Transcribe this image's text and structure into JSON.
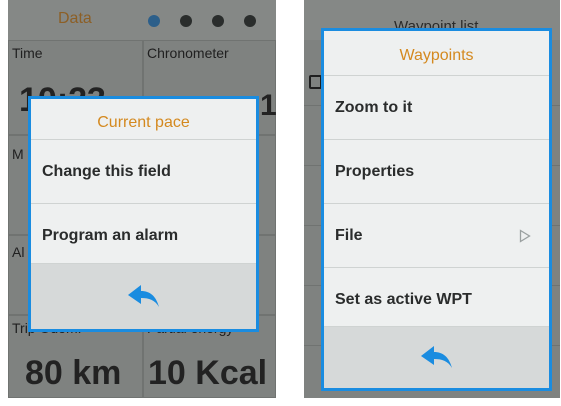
{
  "left": {
    "background": {
      "tab_label": "Data",
      "cells": {
        "time_label": "Time",
        "time_value": "10:23",
        "chrono_label": "Chronometer",
        "chrono_value": "1",
        "m_label": "M",
        "alt_label": "Al",
        "trip_label": "Trip Odom.",
        "trip_value": "80 km",
        "energy_label": "Partial energy",
        "energy_value": "10 Kcal"
      }
    },
    "dialog": {
      "title": "Current pace",
      "items": [
        "Change this field",
        "Program an alarm"
      ],
      "back_icon": "back-arrow-icon"
    }
  },
  "right": {
    "background": {
      "header": "Waypoint list"
    },
    "dialog": {
      "title": "Waypoints",
      "items": [
        "Zoom to it",
        "Properties",
        "File",
        "Set as active WPT"
      ],
      "file_submenu_icon": "chevron-right-icon",
      "back_icon": "back-arrow-icon"
    }
  },
  "colors": {
    "accent": "#1a8ce0",
    "title": "#d4891f",
    "dialog_bg": "#eef0f0",
    "back_bar": "#d6d9d9"
  }
}
